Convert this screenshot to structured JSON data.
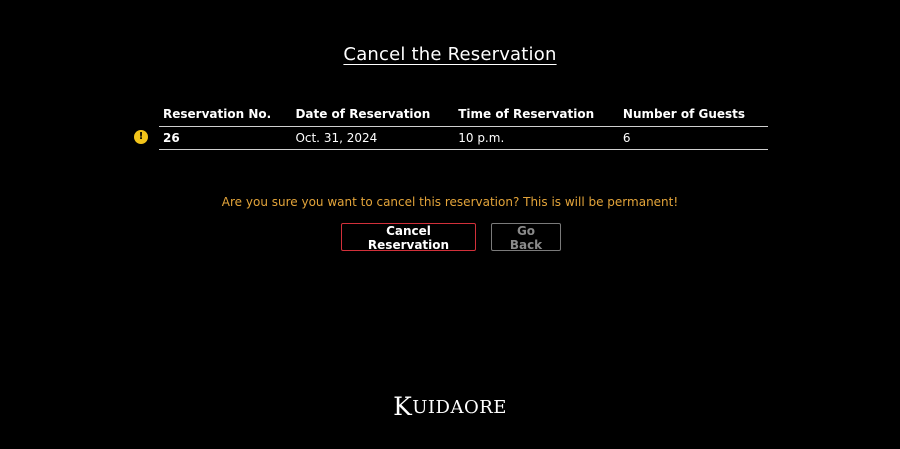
{
  "page": {
    "title": "Cancel the Reservation"
  },
  "table": {
    "headers": [
      "Reservation No.",
      "Date of Reservation",
      "Time of Reservation",
      "Number of Guests"
    ],
    "row": {
      "reservation_no": "26",
      "date": "Oct. 31, 2024",
      "time": "10 p.m.",
      "guests": "6"
    },
    "warning_icon": "exclamation-circle-icon",
    "warning_glyph": "!"
  },
  "confirm": {
    "message": "Are you sure you want to cancel this reservation? This is will be permanent!"
  },
  "buttons": {
    "cancel_label": "Cancel Reservation",
    "back_label": "Go Back"
  },
  "footer": {
    "logo_first": "K",
    "logo_rest": "UIDAORE"
  },
  "colors": {
    "background": "#000000",
    "text": "#ffffff",
    "warning_text": "#e3a43a",
    "warning_icon": "#f2c41a",
    "cancel_border": "#d2303a",
    "back_border": "#7a7a7a"
  }
}
